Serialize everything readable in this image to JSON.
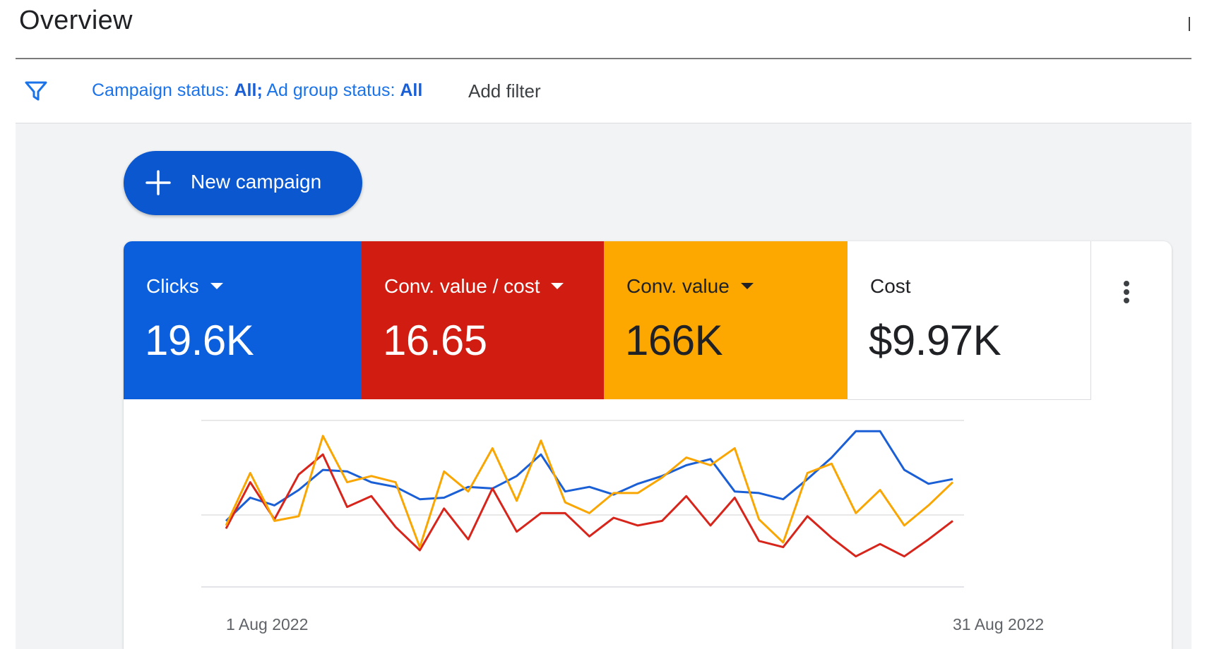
{
  "page": {
    "title": "Overview"
  },
  "filter": {
    "prefix1": "Campaign status:",
    "value1": "All;",
    "prefix2": "Ad group status:",
    "value2": "All",
    "add_filter": "Add filter"
  },
  "actions": {
    "new_campaign": "New campaign"
  },
  "metrics": [
    {
      "label": "Clicks",
      "value": "19.6K",
      "color": "#0b5fdc",
      "has_dropdown": true
    },
    {
      "label": "Conv. value / cost",
      "value": "16.65",
      "color": "#d01c11",
      "has_dropdown": true
    },
    {
      "label": "Conv. value",
      "value": "166K",
      "color": "#fca800",
      "has_dropdown": true
    },
    {
      "label": "Cost",
      "value": "$9.97K",
      "color": "#ffffff",
      "has_dropdown": false
    }
  ],
  "icons": {
    "filter": "filter-icon",
    "add": "plus-icon",
    "more": "more-vert-icon",
    "dropdown": "caret-down-icon"
  },
  "chart_data": {
    "type": "line",
    "x_start_label": "1 Aug 2022",
    "x_end_label": "31 Aug 2022",
    "x": [
      "1 Aug",
      "2 Aug",
      "3 Aug",
      "4 Aug",
      "5 Aug",
      "6 Aug",
      "7 Aug",
      "8 Aug",
      "9 Aug",
      "10 Aug",
      "11 Aug",
      "12 Aug",
      "13 Aug",
      "14 Aug",
      "15 Aug",
      "16 Aug",
      "17 Aug",
      "18 Aug",
      "19 Aug",
      "20 Aug",
      "21 Aug",
      "22 Aug",
      "23 Aug",
      "24 Aug",
      "25 Aug",
      "26 Aug",
      "27 Aug",
      "28 Aug",
      "29 Aug",
      "30 Aug",
      "31 Aug"
    ],
    "ylim": [
      0,
      1
    ],
    "grid": true,
    "series": [
      {
        "color": "#1a5fd6",
        "values": [
          0.35,
          0.5,
          0.45,
          0.55,
          0.68,
          0.67,
          0.6,
          0.57,
          0.49,
          0.5,
          0.57,
          0.56,
          0.64,
          0.78,
          0.54,
          0.57,
          0.52,
          0.59,
          0.64,
          0.71,
          0.75,
          0.54,
          0.53,
          0.49,
          0.62,
          0.76,
          0.93,
          0.93,
          0.68,
          0.59,
          0.62
        ]
      },
      {
        "color": "#d7251b",
        "values": [
          0.3,
          0.6,
          0.36,
          0.65,
          0.78,
          0.44,
          0.51,
          0.31,
          0.16,
          0.43,
          0.23,
          0.56,
          0.28,
          0.4,
          0.4,
          0.25,
          0.37,
          0.32,
          0.35,
          0.51,
          0.32,
          0.5,
          0.22,
          0.18,
          0.38,
          0.24,
          0.12,
          0.2,
          0.12,
          0.23,
          0.35
        ]
      },
      {
        "color": "#f9a602",
        "values": [
          0.32,
          0.66,
          0.35,
          0.38,
          0.9,
          0.6,
          0.64,
          0.6,
          0.18,
          0.67,
          0.54,
          0.82,
          0.48,
          0.87,
          0.47,
          0.4,
          0.53,
          0.53,
          0.63,
          0.76,
          0.71,
          0.82,
          0.36,
          0.21,
          0.66,
          0.72,
          0.4,
          0.55,
          0.32,
          0.45,
          0.6
        ]
      }
    ]
  }
}
